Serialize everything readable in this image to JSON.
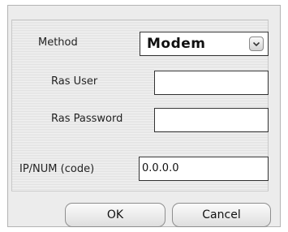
{
  "form": {
    "method_label": "Method",
    "method_value": "Modem",
    "ras_user_label": "Ras User",
    "ras_user_value": "",
    "ras_password_label": "Ras Password",
    "ras_password_value": "",
    "ipnum_label": "IP/NUM (code)",
    "ipnum_value": "0.0.0.0"
  },
  "buttons": {
    "ok_label": "OK",
    "cancel_label": "Cancel"
  },
  "icons": {
    "dropdown": "chevron-down-icon"
  }
}
